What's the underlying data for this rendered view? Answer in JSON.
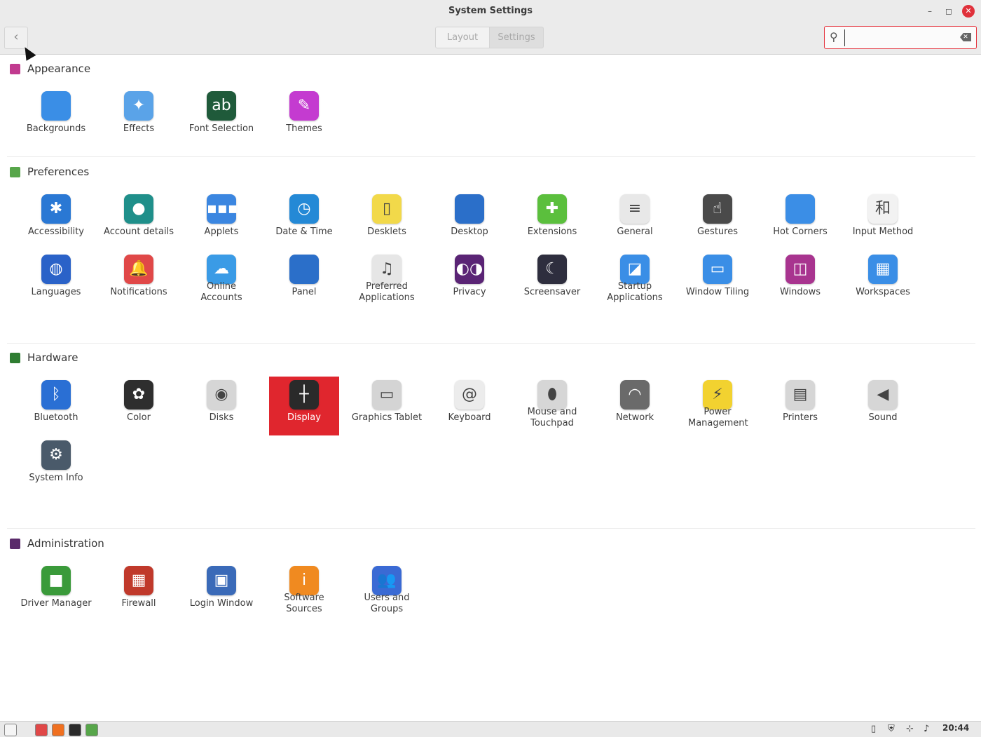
{
  "window": {
    "title": "System Settings",
    "minimize": "–",
    "maximize": "◻",
    "close": "✕"
  },
  "header": {
    "back": "‹",
    "tabs": [
      "Layout",
      "Settings"
    ],
    "search_value": "",
    "search_icon": "⚲",
    "clear_icon": "✕"
  },
  "sections": [
    {
      "title": "Appearance",
      "icon_color": "#c13a8f",
      "items": [
        {
          "label": "Backgrounds",
          "icon": "backgrounds-icon",
          "bg": "#3a8ee6",
          "glyph": ""
        },
        {
          "label": "Effects",
          "icon": "effects-icon",
          "bg": "#5aa3e8",
          "glyph": "✦"
        },
        {
          "label": "Font Selection",
          "icon": "font-selection-icon",
          "bg": "#1f5a3a",
          "glyph": "ab"
        },
        {
          "label": "Themes",
          "icon": "themes-icon",
          "bg": "#c43bd0",
          "glyph": "✎"
        }
      ]
    },
    {
      "title": "Preferences",
      "icon_color": "#57a64a",
      "items": [
        {
          "label": "Accessibility",
          "icon": "accessibility-icon",
          "bg": "#2a78d4",
          "glyph": "✱"
        },
        {
          "label": "Account details",
          "icon": "account-details-icon",
          "bg": "#1f8f8a",
          "glyph": "●"
        },
        {
          "label": "Applets",
          "icon": "applets-icon",
          "bg": "#3b86e0",
          "glyph": "▪▪▪"
        },
        {
          "label": "Date & Time",
          "icon": "date-time-icon",
          "bg": "#2489d6",
          "glyph": "◷"
        },
        {
          "label": "Desklets",
          "icon": "desklets-icon",
          "bg": "#f2d94a",
          "glyph": "▯"
        },
        {
          "label": "Desktop",
          "icon": "desktop-icon",
          "bg": "#2b6fc9",
          "glyph": ""
        },
        {
          "label": "Extensions",
          "icon": "extensions-icon",
          "bg": "#5bbf3d",
          "glyph": "✚"
        },
        {
          "label": "General",
          "icon": "general-icon",
          "bg": "#e8e8e8",
          "glyph": "≡"
        },
        {
          "label": "Gestures",
          "icon": "gestures-icon",
          "bg": "#4a4a4a",
          "glyph": "☝"
        },
        {
          "label": "Hot Corners",
          "icon": "hot-corners-icon",
          "bg": "#3b8ee6",
          "glyph": ""
        },
        {
          "label": "Input Method",
          "icon": "input-method-icon",
          "bg": "#f2f2f2",
          "glyph": "和"
        },
        {
          "label": "Languages",
          "icon": "languages-icon",
          "bg": "#2a62c8",
          "glyph": "◍"
        },
        {
          "label": "Notifications",
          "icon": "notifications-icon",
          "bg": "#e04848",
          "glyph": "🔔"
        },
        {
          "label": "Online Accounts",
          "icon": "online-accounts-icon",
          "bg": "#3a9be6",
          "glyph": "☁"
        },
        {
          "label": "Panel",
          "icon": "panel-icon",
          "bg": "#2b6fc9",
          "glyph": ""
        },
        {
          "label": "Preferred Applications",
          "icon": "preferred-applications-icon",
          "bg": "#e6e6e6",
          "glyph": "♫"
        },
        {
          "label": "Privacy",
          "icon": "privacy-icon",
          "bg": "#5a2475",
          "glyph": "◐◑"
        },
        {
          "label": "Screensaver",
          "icon": "screensaver-icon",
          "bg": "#2e2e3e",
          "glyph": "☾"
        },
        {
          "label": "Startup Applications",
          "icon": "startup-applications-icon",
          "bg": "#3a8ee6",
          "glyph": "◪"
        },
        {
          "label": "Window Tiling",
          "icon": "window-tiling-icon",
          "bg": "#3a8ee6",
          "glyph": "▭"
        },
        {
          "label": "Windows",
          "icon": "windows-icon",
          "bg": "#a8348f",
          "glyph": "◫"
        },
        {
          "label": "Workspaces",
          "icon": "workspaces-icon",
          "bg": "#3a8ee6",
          "glyph": "▦"
        }
      ]
    },
    {
      "title": "Hardware",
      "icon_color": "#2f7d32",
      "items": [
        {
          "label": "Bluetooth",
          "icon": "bluetooth-icon",
          "bg": "#2a6fd4",
          "glyph": "ᛒ"
        },
        {
          "label": "Color",
          "icon": "color-icon",
          "bg": "#2e2e2e",
          "glyph": "✿"
        },
        {
          "label": "Disks",
          "icon": "disks-icon",
          "bg": "#d6d6d6",
          "glyph": "◉"
        },
        {
          "label": "Display",
          "icon": "display-icon",
          "bg": "#2a2a2a",
          "glyph": "┼"
        },
        {
          "label": "Graphics Tablet",
          "icon": "graphics-tablet-icon",
          "bg": "#d4d4d4",
          "glyph": "▭"
        },
        {
          "label": "Keyboard",
          "icon": "keyboard-icon",
          "bg": "#ececec",
          "glyph": "@"
        },
        {
          "label": "Mouse and Touchpad",
          "icon": "mouse-touchpad-icon",
          "bg": "#d6d6d6",
          "glyph": "⬮"
        },
        {
          "label": "Network",
          "icon": "network-icon",
          "bg": "#6a6a6a",
          "glyph": "◠"
        },
        {
          "label": "Power Management",
          "icon": "power-management-icon",
          "bg": "#f2d230",
          "glyph": "⚡"
        },
        {
          "label": "Printers",
          "icon": "printers-icon",
          "bg": "#d6d6d6",
          "glyph": "▤"
        },
        {
          "label": "Sound",
          "icon": "sound-icon",
          "bg": "#d6d6d6",
          "glyph": "◀"
        },
        {
          "label": "System Info",
          "icon": "system-info-icon",
          "bg": "#4a5a6a",
          "glyph": "⚙"
        }
      ]
    },
    {
      "title": "Administration",
      "icon_color": "#5a2a6a",
      "items": [
        {
          "label": "Driver Manager",
          "icon": "driver-manager-icon",
          "bg": "#3a9a3a",
          "glyph": "■"
        },
        {
          "label": "Firewall",
          "icon": "firewall-icon",
          "bg": "#c0392b",
          "glyph": "▦"
        },
        {
          "label": "Login Window",
          "icon": "login-window-icon",
          "bg": "#3a6ab8",
          "glyph": "▣"
        },
        {
          "label": "Software Sources",
          "icon": "software-sources-icon",
          "bg": "#f08a20",
          "glyph": "i"
        },
        {
          "label": "Users and Groups",
          "icon": "users-groups-icon",
          "bg": "#3a6ad4",
          "glyph": "👥"
        }
      ]
    }
  ],
  "selected": "Display",
  "taskbar": {
    "clock": "20:44",
    "apps": [
      {
        "name": "menu-icon",
        "color": "#f5f5f5"
      },
      {
        "name": "files-icon",
        "color": "#e04848"
      },
      {
        "name": "firefox-icon",
        "color": "#f07020"
      },
      {
        "name": "terminal-icon",
        "color": "#2a2a2a"
      },
      {
        "name": "settings-app-icon",
        "color": "#57a64a"
      }
    ],
    "tray": [
      {
        "name": "clipboard-icon",
        "glyph": "▯"
      },
      {
        "name": "shield-icon",
        "glyph": "⛨"
      },
      {
        "name": "network-tray-icon",
        "glyph": "⊹"
      },
      {
        "name": "volume-icon",
        "glyph": "♪"
      }
    ]
  }
}
